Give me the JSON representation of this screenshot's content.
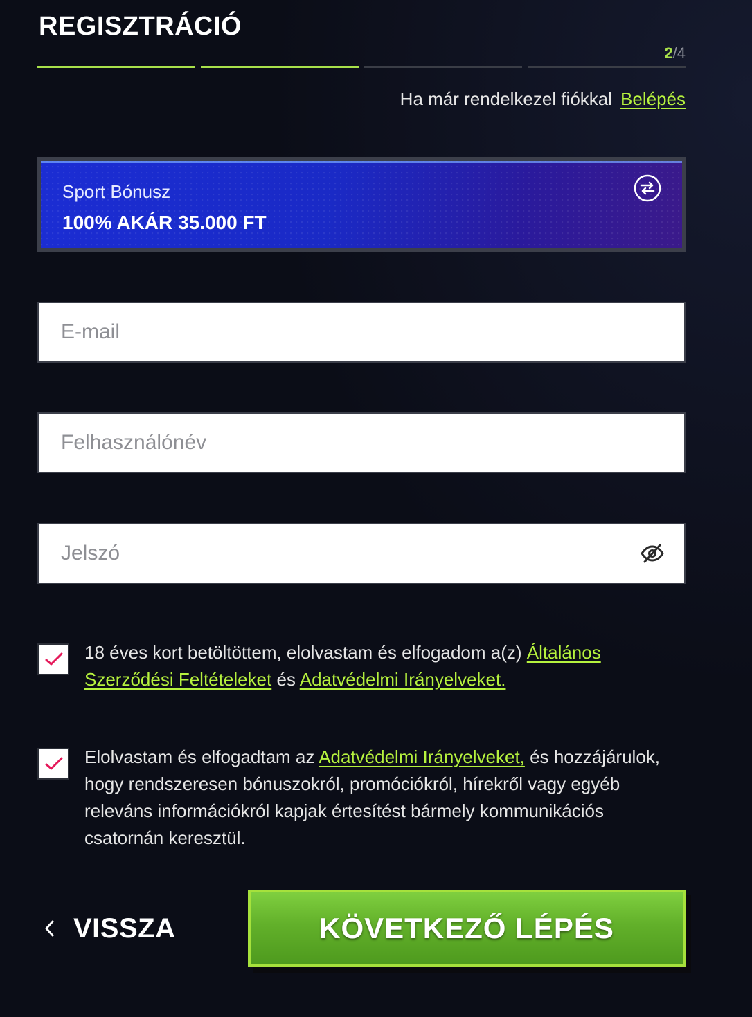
{
  "header": {
    "title": "REGISZTRÁCIÓ",
    "step_current": "2",
    "step_separator": "/",
    "step_total": "4",
    "progress": {
      "completed_steps": 2,
      "total_steps": 4
    }
  },
  "login": {
    "prompt": "Ha már rendelkezel fiókkal",
    "link": "Belépés"
  },
  "bonus": {
    "label": "Sport Bónusz",
    "value": "100% AKÁR 35.000 FT",
    "swap_icon": "swap-arrows-icon"
  },
  "form": {
    "email_placeholder": "E-mail",
    "email_value": "",
    "username_placeholder": "Felhasználónév",
    "username_value": "",
    "password_placeholder": "Jelszó",
    "password_value": "",
    "password_toggle_icon": "eye-off-icon"
  },
  "consents": {
    "age": {
      "checked": true,
      "text_before": "18 éves kort betöltöttem, elolvastam és elfogadom a(z) ",
      "link_terms": "Általános Szerződési Feltételeket",
      "text_middle": " és ",
      "link_privacy": "Adatvédelmi Irányelveket."
    },
    "marketing": {
      "checked": true,
      "text_before": "Elolvastam és elfogadtam az ",
      "link_privacy": "Adatvédelmi Irányelveket,",
      "text_after": " és hozzájárulok, hogy rendszeresen bónuszokról, promóciókról, hírekről vagy egyéb releváns információkról kapjak értesítést bármely kommunikációs csatornán keresztül."
    }
  },
  "actions": {
    "back_label": "VISSZA",
    "next_label": "KÖVETKEZŐ LÉPÉS"
  },
  "colors": {
    "accent_green": "#b6f23e",
    "check_pink": "#e5195a",
    "bonus_blue": "#1b2dd3",
    "button_green": "#62b02a",
    "background": "#0b0d17"
  }
}
